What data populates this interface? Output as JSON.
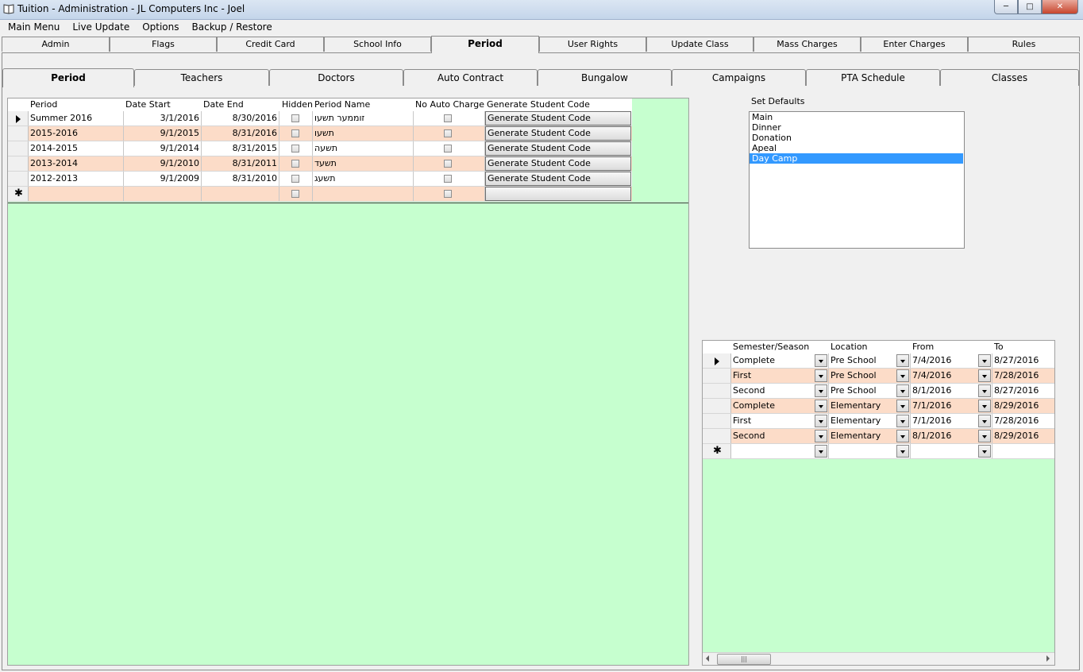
{
  "window": {
    "title": "Tuition - Administration - JL Computers Inc - Joel"
  },
  "menu": [
    "Main Menu",
    "Live Update",
    "Options",
    "Backup / Restore"
  ],
  "tabs_top": [
    "Admin",
    "Flags",
    "Credit Card",
    "School Info",
    "Period",
    "User Rights",
    "Update Class",
    "Mass Charges",
    "Enter Charges",
    "Rules"
  ],
  "tabs_top_active": "Period",
  "tabs_sub": [
    "Period",
    "Teachers",
    "Doctors",
    "Auto Contract",
    "Bungalow",
    "Campaigns",
    "PTA Schedule",
    "Classes"
  ],
  "tabs_sub_active": "Period",
  "period_grid": {
    "columns": [
      "Period",
      "Date Start",
      "Date End",
      "Hidden",
      "Period Name",
      "No Auto Charge",
      "Generate Student Code"
    ],
    "rows": [
      {
        "period": "Summer 2016",
        "date_start": "3/1/2016",
        "date_end": "8/30/2016",
        "period_name": "זוממער תשעו",
        "button": "Generate Student Code"
      },
      {
        "period": "2015-2016",
        "date_start": "9/1/2015",
        "date_end": "8/31/2016",
        "period_name": "תשעו",
        "button": "Generate Student Code"
      },
      {
        "period": "2014-2015",
        "date_start": "9/1/2014",
        "date_end": "8/31/2015",
        "period_name": "תשעה",
        "button": "Generate Student Code"
      },
      {
        "period": "2013-2014",
        "date_start": "9/1/2010",
        "date_end": "8/31/2011",
        "period_name": "תשעד",
        "button": "Generate Student Code"
      },
      {
        "period": "2012-2013",
        "date_start": "9/1/2009",
        "date_end": "8/31/2010",
        "period_name": "תשעג",
        "button": "Generate Student Code"
      }
    ]
  },
  "set_defaults": {
    "label": "Set Defaults",
    "items": [
      "Main",
      "Dinner",
      "Donation",
      "Apeal",
      "Day Camp"
    ],
    "selected": "Day Camp"
  },
  "semester_grid": {
    "columns": [
      "Semester/Season",
      "Location",
      "From",
      "To"
    ],
    "rows": [
      {
        "semester": "Complete",
        "location": "Pre School",
        "from": "7/4/2016",
        "to": "8/27/2016"
      },
      {
        "semester": "First",
        "location": "Pre School",
        "from": "7/4/2016",
        "to": "7/28/2016"
      },
      {
        "semester": "Second",
        "location": "Pre School",
        "from": "8/1/2016",
        "to": "8/27/2016"
      },
      {
        "semester": "Complete",
        "location": "Elementary",
        "from": "7/1/2016",
        "to": "8/29/2016"
      },
      {
        "semester": "First",
        "location": "Elementary",
        "from": "7/1/2016",
        "to": "7/28/2016"
      },
      {
        "semester": "Second",
        "location": "Elementary",
        "from": "8/1/2016",
        "to": "8/29/2016"
      }
    ]
  },
  "icons": {
    "app": "book-icon",
    "minimize": "minimize-icon",
    "maximize": "maximize-icon",
    "close": "close-icon"
  },
  "colors": {
    "grid_bg": "#c6ffcf",
    "alt_row": "#fcdcc8",
    "selection": "#3399ff"
  }
}
